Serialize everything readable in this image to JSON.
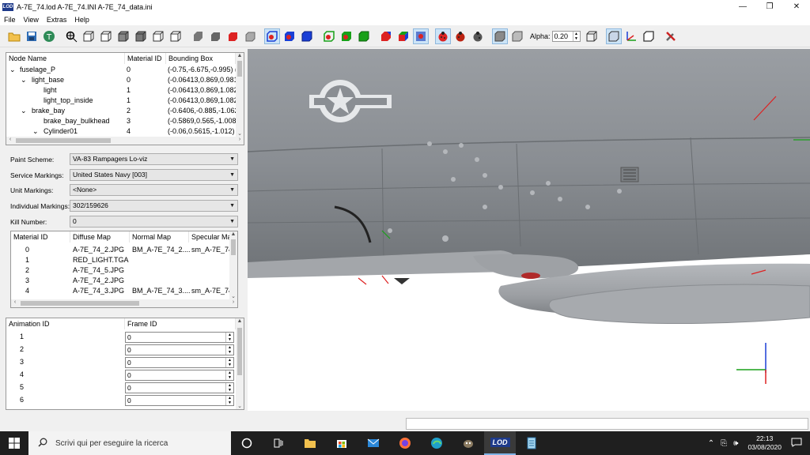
{
  "window": {
    "logo_text": "LOD",
    "title": "A-7E_74.lod  A-7E_74.INI  A-7E_74_data.ini",
    "minimize": "—",
    "maximize": "❐",
    "close": "✕"
  },
  "menu": [
    "File",
    "View",
    "Extras",
    "Help"
  ],
  "toolbar": {
    "alpha_label": "Alpha:",
    "alpha_value": "0.20"
  },
  "node_tree": {
    "headers": [
      "Node Name",
      "Material ID",
      "Bounding Box"
    ],
    "rows": [
      {
        "expander": "⌄",
        "name": "fuselage_P",
        "material": "0",
        "bbox": "(-0.75,-6.675,-0.995) ("
      },
      {
        "expander": "⌄",
        "name": "light_base",
        "material": "0",
        "bbox": "(-0.06413,0.869,0.9812"
      },
      {
        "expander": "",
        "name": "light",
        "material": "1",
        "bbox": "(-0.06413,0.869,1.082)"
      },
      {
        "expander": "",
        "name": "light_top_inside",
        "material": "1",
        "bbox": "(-0.06413,0.869,1.082)"
      },
      {
        "expander": "⌄",
        "name": "brake_bay",
        "material": "2",
        "bbox": "(-0.6406,-0.885,-1.062"
      },
      {
        "expander": "",
        "name": "brake_bay_bulkhead",
        "material": "3",
        "bbox": "(-0.5869,0.565,-1.008)"
      },
      {
        "expander": "⌄",
        "name": "Cylinder01",
        "material": "4",
        "bbox": "(-0.06,0.5615,-1.012) ("
      }
    ]
  },
  "properties": [
    {
      "label": "Paint Scheme:",
      "value": "VA-83 Rampagers Lo-viz"
    },
    {
      "label": "Service Markings:",
      "value": "United States Navy [003]"
    },
    {
      "label": "Unit Markings:",
      "value": "<None>"
    },
    {
      "label": "Individual Markings:",
      "value": "302/159626"
    },
    {
      "label": "Kill Number:",
      "value": "0"
    }
  ],
  "materials": {
    "headers": [
      "Material ID",
      "Diffuse Map",
      "Normal Map",
      "Specular Ma"
    ],
    "rows": [
      {
        "id": "0",
        "diffuse": "A-7E_74_2.JPG",
        "normal": "BM_A-7E_74_2....",
        "specular": "sm_A-7E_74"
      },
      {
        "id": "1",
        "diffuse": "RED_LIGHT.TGA",
        "normal": "",
        "specular": ""
      },
      {
        "id": "2",
        "diffuse": "A-7E_74_5.JPG",
        "normal": "",
        "specular": ""
      },
      {
        "id": "3",
        "diffuse": "A-7E_74_2.JPG",
        "normal": "",
        "specular": ""
      },
      {
        "id": "4",
        "diffuse": "A-7E_74_3.JPG",
        "normal": "BM_A-7E_74_3....",
        "specular": "sm_A-7E_74"
      }
    ]
  },
  "animations": {
    "headers": [
      "Animation ID",
      "Frame ID"
    ],
    "rows": [
      {
        "id": "1",
        "frame": "0"
      },
      {
        "id": "2",
        "frame": "0"
      },
      {
        "id": "3",
        "frame": "0"
      },
      {
        "id": "4",
        "frame": "0"
      },
      {
        "id": "5",
        "frame": "0"
      },
      {
        "id": "6",
        "frame": "0"
      }
    ]
  },
  "taskbar": {
    "search_placeholder": "Scrivi qui per eseguire la ricerca",
    "time": "22:13",
    "date": "03/08/2020",
    "lod_label": "LOD"
  },
  "colors": {
    "accent": "#1e3a8a",
    "toolbar_active": "#cce4f7",
    "taskbar": "#1f1f1f"
  }
}
